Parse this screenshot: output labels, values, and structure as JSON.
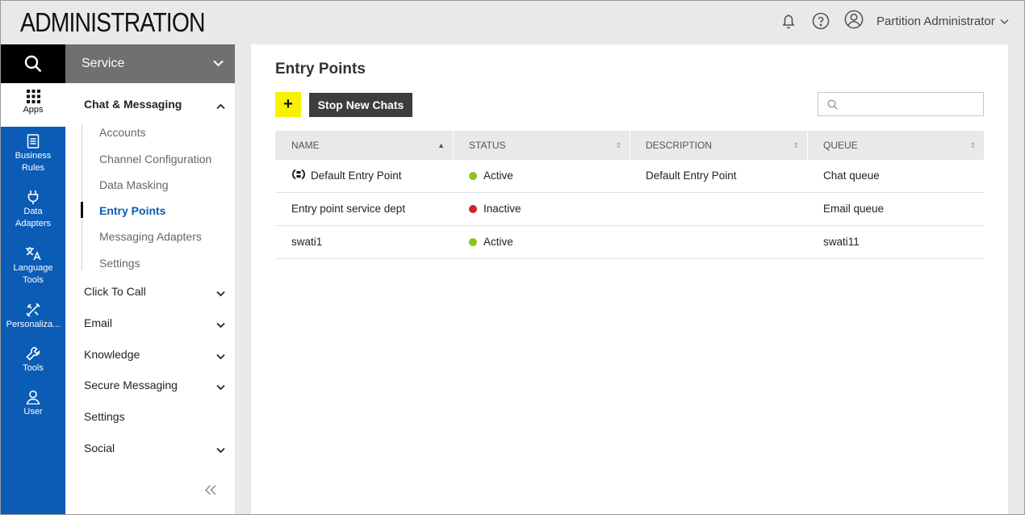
{
  "header": {
    "title": "ADMINISTRATION",
    "user_label": "Partition Administrator",
    "icons": [
      "bell-icon",
      "help-icon",
      "user-circle-icon"
    ]
  },
  "rail": {
    "items": [
      {
        "label": "Apps",
        "icon": "apps-grid-icon"
      },
      {
        "label_1": "Business",
        "label_2": "Rules",
        "icon": "document-icon"
      },
      {
        "label_1": "Data",
        "label_2": "Adapters",
        "icon": "plug-icon"
      },
      {
        "label_1": "Language",
        "label_2": "Tools",
        "icon": "translate-icon"
      },
      {
        "label": "Personaliza...",
        "icon": "personalization-icon"
      },
      {
        "label": "Tools",
        "icon": "wrench-icon"
      },
      {
        "label": "User",
        "icon": "person-icon"
      }
    ]
  },
  "nav": {
    "section": "Service",
    "groups": [
      {
        "label": "Chat & Messaging"
      },
      {
        "label": "Click To Call"
      },
      {
        "label": "Email"
      },
      {
        "label": "Knowledge"
      },
      {
        "label": "Secure Messaging"
      },
      {
        "label": "Settings"
      },
      {
        "label": "Social"
      }
    ],
    "sub_items": [
      {
        "label": "Accounts"
      },
      {
        "label": "Channel Configuration"
      },
      {
        "label": "Data Masking"
      },
      {
        "label": "Entry Points"
      },
      {
        "label": "Messaging Adapters"
      },
      {
        "label": "Settings"
      }
    ]
  },
  "main": {
    "title": "Entry Points",
    "add_label": "+",
    "stop_label": "Stop New Chats",
    "search_placeholder": "",
    "columns": [
      "NAME",
      "STATUS",
      "DESCRIPTION",
      "QUEUE"
    ],
    "rows": [
      {
        "name": "Default Entry Point",
        "status": "Active",
        "description": "Default Entry Point",
        "queue": "Chat queue"
      },
      {
        "name": "Entry point service dept",
        "status": "Inactive",
        "description": "",
        "queue": "Email queue"
      },
      {
        "name": "swati1",
        "status": "Active",
        "description": "",
        "queue": "swati11"
      }
    ]
  },
  "colors": {
    "rail": "#0a5cb5",
    "active": "#8dc21f",
    "inactive": "#c8262d",
    "add_button": "#f7f200"
  }
}
